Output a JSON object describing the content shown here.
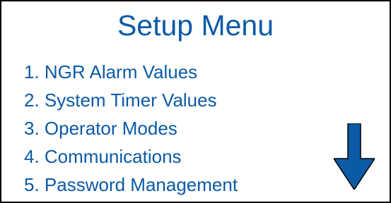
{
  "screen": {
    "title": "Setup Menu",
    "accent_color": "#0b5aa6",
    "border_color": "#000000"
  },
  "menu": {
    "items": [
      {
        "label": "1. NGR Alarm Values"
      },
      {
        "label": "2. System Timer Values"
      },
      {
        "label": "3. Operator Modes"
      },
      {
        "label": "4. Communications"
      },
      {
        "label": "5. Password Management"
      }
    ]
  },
  "scroll": {
    "icon": "arrow-down-icon"
  }
}
